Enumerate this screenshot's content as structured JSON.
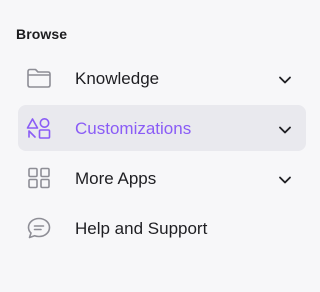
{
  "section": {
    "title": "Browse"
  },
  "nav": {
    "items": [
      {
        "label": "Knowledge",
        "icon": "folder-icon",
        "expandable": true,
        "active": false
      },
      {
        "label": "Customizations",
        "icon": "shapes-icon",
        "expandable": true,
        "active": true
      },
      {
        "label": "More Apps",
        "icon": "grid-icon",
        "expandable": true,
        "active": false
      },
      {
        "label": "Help and Support",
        "icon": "chat-bubble-icon",
        "expandable": false,
        "active": false
      }
    ]
  },
  "colors": {
    "accent": "#8a5cf6",
    "active_bg": "#e9e9ee",
    "icon_gray": "#8e8e96",
    "text": "#1e1e22",
    "background": "#f7f7f9"
  }
}
